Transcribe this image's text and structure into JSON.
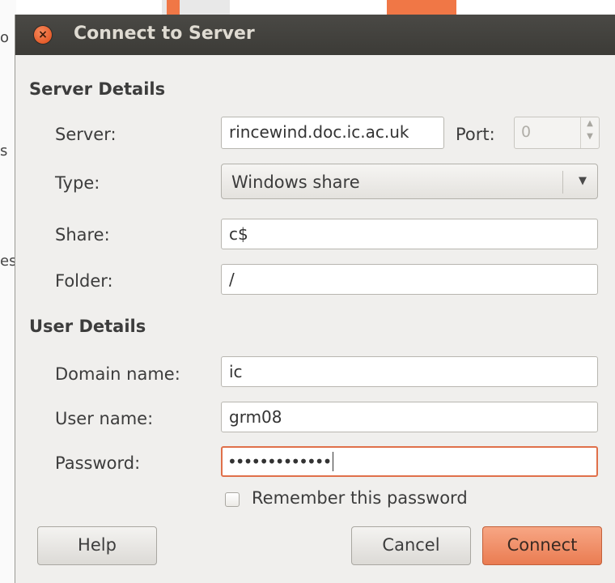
{
  "background": {
    "peek_chars": [
      "o",
      "s",
      "es"
    ]
  },
  "window": {
    "title": "Connect to Server",
    "close_icon": "close-icon"
  },
  "server_details": {
    "heading": "Server Details",
    "server_label": "Server:",
    "server_value": "rincewind.doc.ic.ac.uk",
    "port_label": "Port:",
    "port_value": "0",
    "type_label": "Type:",
    "type_value": "Windows share",
    "share_label": "Share:",
    "share_value": "c$",
    "folder_label": "Folder:",
    "folder_value": "/"
  },
  "user_details": {
    "heading": "User Details",
    "domain_label": "Domain name:",
    "domain_value": "ic",
    "user_label": "User name:",
    "user_value": "grm08",
    "password_label": "Password:",
    "password_value": "•••••••••••••",
    "remember_label": "Remember this password",
    "remember_checked": false
  },
  "buttons": {
    "help": "Help",
    "cancel": "Cancel",
    "connect": "Connect"
  },
  "colors": {
    "accent": "#e0704a",
    "titlebar": "#3c3b37",
    "dialog_bg": "#f0efed"
  }
}
